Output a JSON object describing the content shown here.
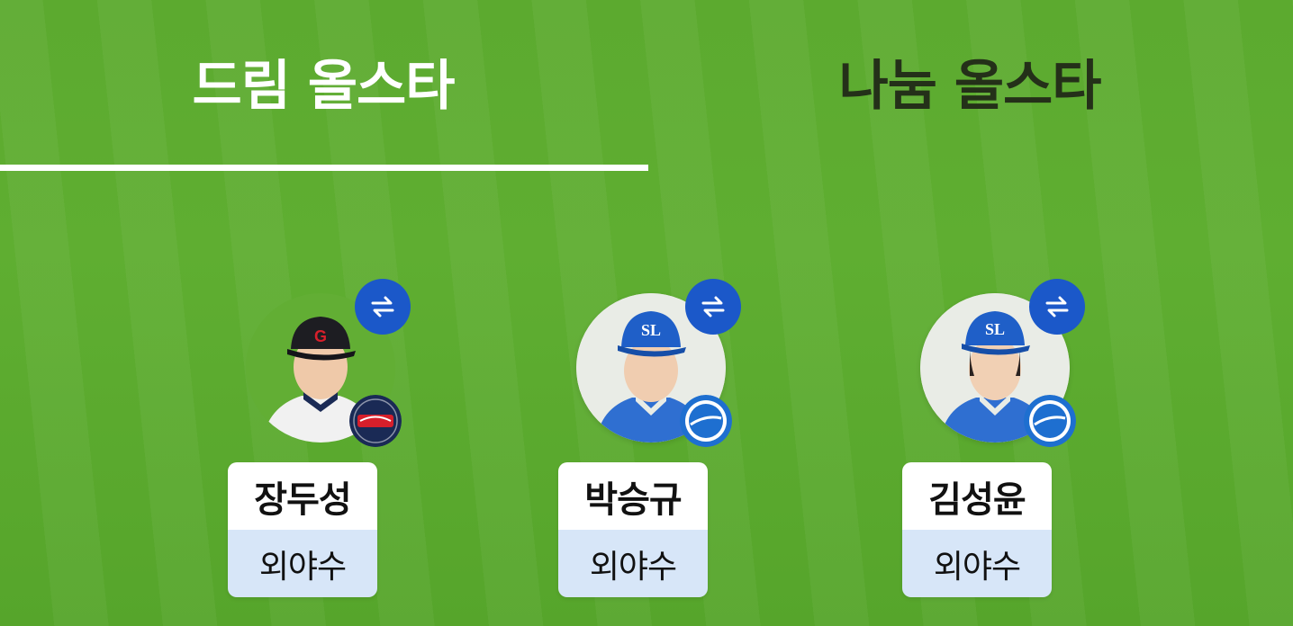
{
  "tabs": [
    {
      "label": "드림 올스타",
      "active": true
    },
    {
      "label": "나눔 올스타",
      "active": false
    }
  ],
  "players": [
    {
      "name": "장두성",
      "position": "외야수",
      "team_logo": "giants-logo",
      "cap_letter": "G"
    },
    {
      "name": "박승규",
      "position": "외야수",
      "team_logo": "lions-logo",
      "cap_letter": "SL"
    },
    {
      "name": "김성윤",
      "position": "외야수",
      "team_logo": "lions-logo",
      "cap_letter": "SL"
    }
  ],
  "swap_icon": "swap-arrows-icon",
  "colors": {
    "field_green": "#5aa82e",
    "tab_active_text": "#ffffff",
    "tab_inactive_text": "#243019",
    "swap_button": "#1b58c9",
    "position_bg": "#d7e6f8",
    "giants_navy": "#1a2a55",
    "giants_red": "#d71f2b",
    "lions_blue": "#1e6fd0"
  }
}
